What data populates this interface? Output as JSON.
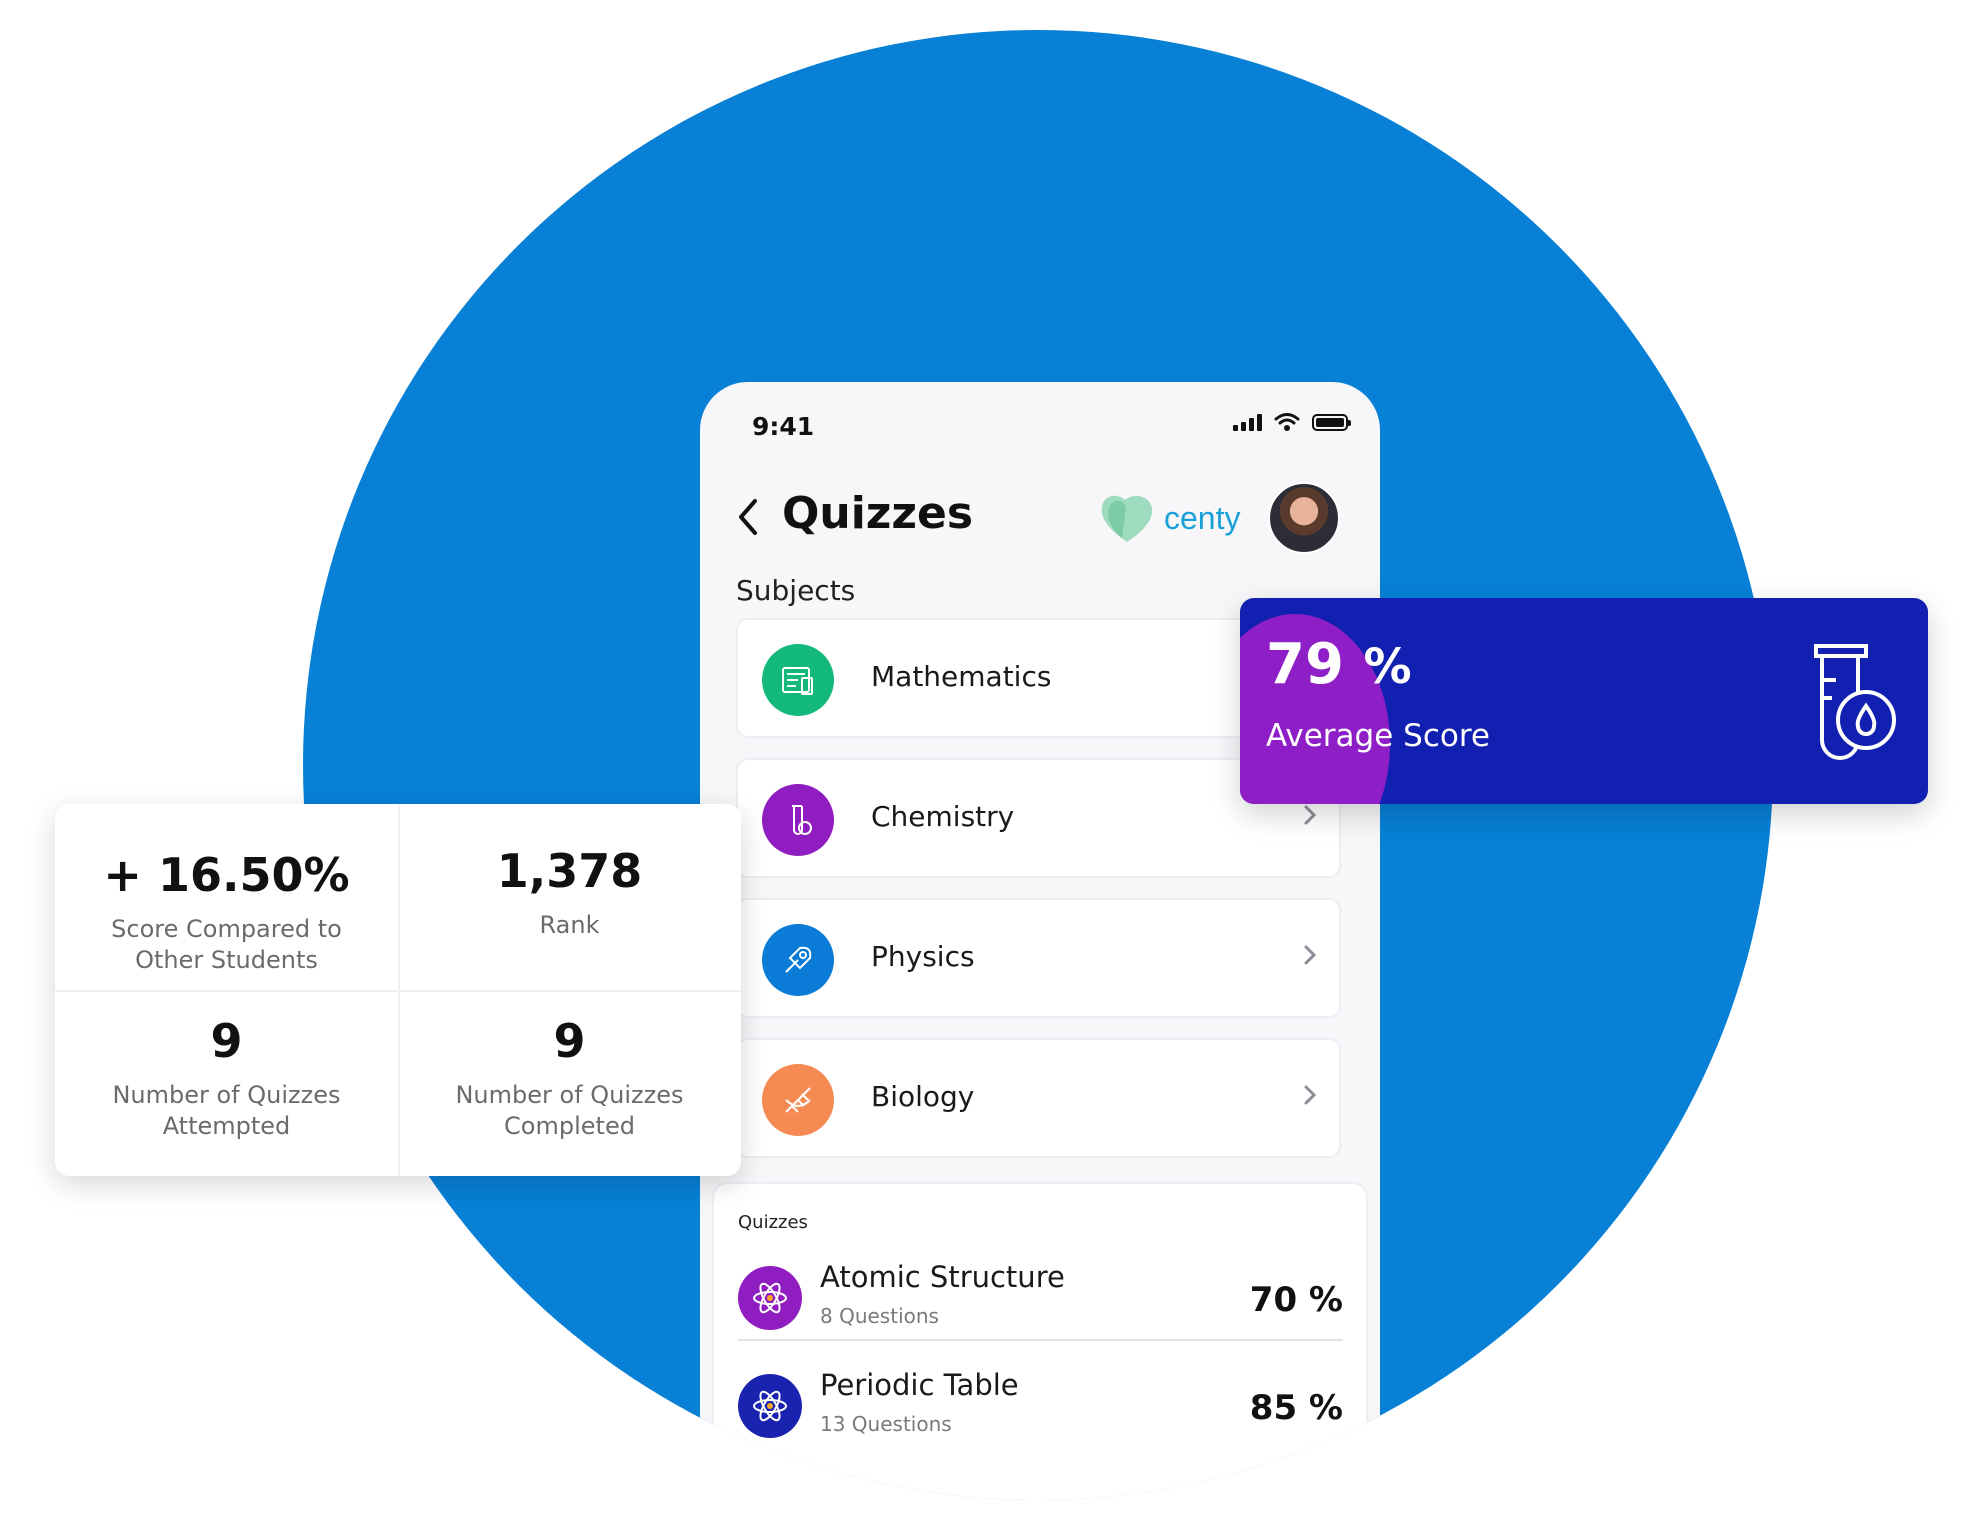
{
  "phone": {
    "status": {
      "time": "9:41"
    },
    "header": {
      "title": "Quizzes",
      "brand": "centy"
    },
    "subjects_label": "Subjects",
    "subjects": [
      {
        "label": "Mathematics",
        "color": "#12b97a",
        "icon": "math-icon"
      },
      {
        "label": "Chemistry",
        "color": "#8f1dbf",
        "icon": "flask-icon"
      },
      {
        "label": "Physics",
        "color": "#0a7bd6",
        "icon": "rocket-icon"
      },
      {
        "label": "Biology",
        "color": "#f58a53",
        "icon": "dna-icon"
      }
    ],
    "quizzes_label": "Quizzes",
    "quizzes": [
      {
        "title": "Atomic Structure",
        "subtitle": "8 Questions",
        "score": "70 %",
        "color": "#8f1dbf"
      },
      {
        "title": "Periodic Table",
        "subtitle": "13 Questions",
        "score": "85 %",
        "color": "#1a23b0"
      }
    ]
  },
  "average_score": {
    "value": "79",
    "unit": "%",
    "label": "Average Score",
    "color": "#1120b0",
    "accent": "#8e1fc6"
  },
  "stats": [
    {
      "value": "+ 16.50%",
      "label": "Score Compared to\nOther Students"
    },
    {
      "value": "1,378",
      "label": "Rank"
    },
    {
      "value": "9",
      "label": "Number of Quizzes\nAttempted"
    },
    {
      "value": "9",
      "label": "Number of Quizzes\nCompleted"
    }
  ]
}
